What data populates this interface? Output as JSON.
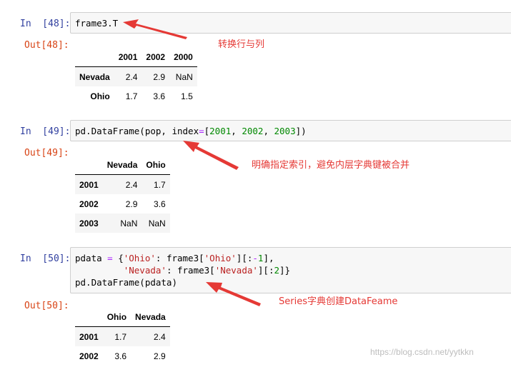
{
  "cells": [
    {
      "in_prompt": "In  [48]:",
      "out_prompt": "Out[48]:",
      "code": "frame3.T",
      "annotation": "转换行与列",
      "table": {
        "columns": [
          "2001",
          "2002",
          "2000"
        ],
        "rows": [
          {
            "index": "Nevada",
            "values": [
              "2.4",
              "2.9",
              "NaN"
            ]
          },
          {
            "index": "Ohio",
            "values": [
              "1.7",
              "3.6",
              "1.5"
            ]
          }
        ]
      }
    },
    {
      "in_prompt": "In  [49]:",
      "out_prompt": "Out[49]:",
      "code_parts": {
        "p1": "pd.DataFrame(pop, index",
        "p2": "=",
        "p3": "[",
        "n1": "2001",
        "p4": ", ",
        "n2": "2002",
        "p5": ", ",
        "n3": "2003",
        "p6": "])"
      },
      "annotation": "明确指定索引，避免内层字典键被合并",
      "table": {
        "columns": [
          "Nevada",
          "Ohio"
        ],
        "rows": [
          {
            "index": "2001",
            "values": [
              "2.4",
              "1.7"
            ]
          },
          {
            "index": "2002",
            "values": [
              "2.9",
              "3.6"
            ]
          },
          {
            "index": "2003",
            "values": [
              "NaN",
              "NaN"
            ]
          }
        ]
      }
    },
    {
      "in_prompt": "In  [50]:",
      "out_prompt": "Out[50]:",
      "code_parts": {
        "l1a": "pdata ",
        "l1b": "=",
        "l1c": " {",
        "l1s1": "'Ohio'",
        "l1d": ": frame3[",
        "l1s2": "'Ohio'",
        "l1e": "][:",
        "l1f": "-",
        "l1n": "1",
        "l1g": "],",
        "l2pad": "         ",
        "l2s1": "'Nevada'",
        "l2a": ": frame3[",
        "l2s2": "'Nevada'",
        "l2b": "][:",
        "l2n": "2",
        "l2c": "]}",
        "l3": "pd.DataFrame(pdata)"
      },
      "annotation": "Series字典创建DataFeame",
      "table": {
        "columns": [
          "Ohio",
          "Nevada"
        ],
        "rows": [
          {
            "index": "2001",
            "values": [
              "1.7",
              "2.4"
            ]
          },
          {
            "index": "2002",
            "values": [
              "3.6",
              "2.9"
            ]
          }
        ]
      }
    }
  ],
  "watermark": "https://blog.csdn.net/yytkkn",
  "colors": {
    "in_prompt": "#303f9f",
    "out_prompt": "#d84315",
    "annotation": "#e53935",
    "keyword": "#aa22ff",
    "number": "#008800",
    "string": "#ba2121"
  }
}
